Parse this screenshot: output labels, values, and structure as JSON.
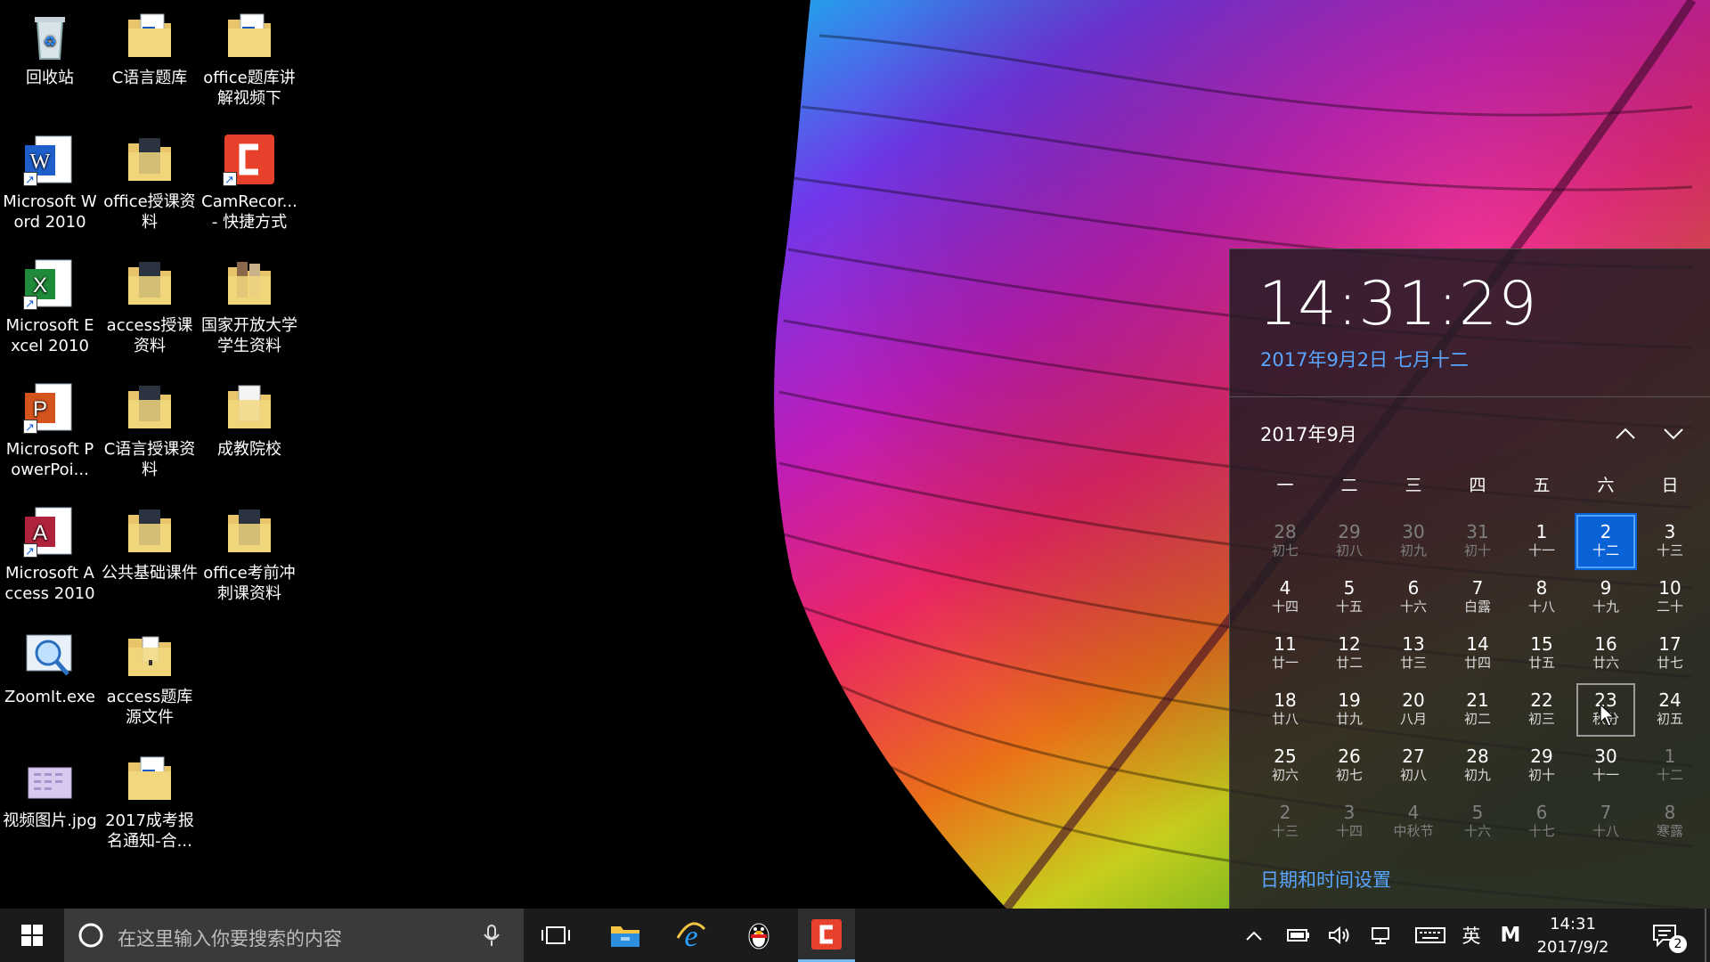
{
  "desktop": {
    "icons": [
      {
        "label": "回收站",
        "type": "recycle-bin-icon"
      },
      {
        "label": "C语言题库",
        "type": "word-doc-folder-icon"
      },
      {
        "label": "office题库讲解视频下",
        "type": "word-doc-folder-icon"
      },
      {
        "label": "Microsoft Word 2010",
        "type": "word-app-icon"
      },
      {
        "label": "office授课资料",
        "type": "folder-icon"
      },
      {
        "label": "CamRecor... - 快捷方式",
        "type": "camtasia-recorder-icon"
      },
      {
        "label": "Microsoft Excel 2010",
        "type": "excel-app-icon"
      },
      {
        "label": "access授课资料",
        "type": "folder-icon"
      },
      {
        "label": "国家开放大学学生资料",
        "type": "folder-icon"
      },
      {
        "label": "Microsoft PowerPoi...",
        "type": "powerpoint-app-icon"
      },
      {
        "label": "C语言授课资料",
        "type": "folder-icon"
      },
      {
        "label": "成教院校",
        "type": "folder-icon"
      },
      {
        "label": "Microsoft Access 2010",
        "type": "access-app-icon"
      },
      {
        "label": "公共基础课件",
        "type": "folder-icon"
      },
      {
        "label": "office考前冲刺课资料",
        "type": "folder-icon"
      },
      {
        "label": "ZoomIt.exe",
        "type": "zoomit-icon"
      },
      {
        "label": "access题库源文件",
        "type": "folder-icon"
      },
      {
        "label": "视频图片.jpg",
        "type": "image-file-icon"
      },
      {
        "label": "2017成考报名通知-合...",
        "type": "word-doc-folder-icon"
      }
    ]
  },
  "flyout": {
    "time": "14:31:29",
    "date_line": "2017年9月2日 七月十二",
    "month_title": "2017年9月",
    "weekdays": [
      "一",
      "二",
      "三",
      "四",
      "五",
      "六",
      "日"
    ],
    "weeks": [
      [
        [
          "28",
          "初七"
        ],
        [
          "29",
          "初八"
        ],
        [
          "30",
          "初九"
        ],
        [
          "31",
          "初十"
        ],
        [
          "1",
          "十一"
        ],
        [
          "2",
          "十二"
        ],
        [
          "3",
          "十三"
        ]
      ],
      [
        [
          "4",
          "十四"
        ],
        [
          "5",
          "十五"
        ],
        [
          "6",
          "十六"
        ],
        [
          "7",
          "白露"
        ],
        [
          "8",
          "十八"
        ],
        [
          "9",
          "十九"
        ],
        [
          "10",
          "二十"
        ]
      ],
      [
        [
          "11",
          "廿一"
        ],
        [
          "12",
          "廿二"
        ],
        [
          "13",
          "廿三"
        ],
        [
          "14",
          "廿四"
        ],
        [
          "15",
          "廿五"
        ],
        [
          "16",
          "廿六"
        ],
        [
          "17",
          "廿七"
        ]
      ],
      [
        [
          "18",
          "廿八"
        ],
        [
          "19",
          "廿九"
        ],
        [
          "20",
          "八月"
        ],
        [
          "21",
          "初二"
        ],
        [
          "22",
          "初三"
        ],
        [
          "23",
          "秋分"
        ],
        [
          "24",
          "初五"
        ]
      ],
      [
        [
          "25",
          "初六"
        ],
        [
          "26",
          "初七"
        ],
        [
          "27",
          "初八"
        ],
        [
          "28",
          "初九"
        ],
        [
          "29",
          "初十"
        ],
        [
          "30",
          "十一"
        ],
        [
          "1",
          "十二"
        ]
      ],
      [
        [
          "2",
          "十三"
        ],
        [
          "3",
          "十四"
        ],
        [
          "4",
          "中秋节"
        ],
        [
          "5",
          "十六"
        ],
        [
          "6",
          "十七"
        ],
        [
          "7",
          "十八"
        ],
        [
          "8",
          "寒露"
        ]
      ]
    ],
    "settings_link": "日期和时间设置"
  },
  "taskbar": {
    "search_placeholder": "在这里输入你要搜索的内容",
    "ime_label": "英",
    "ime_mode": "M",
    "clock_time": "14:31",
    "clock_date": "2017/9/2",
    "notification_count": "2"
  },
  "colors": {
    "accent": "#0a63d6",
    "link": "#5aa5ff",
    "taskbar": "#1b1b1b"
  }
}
